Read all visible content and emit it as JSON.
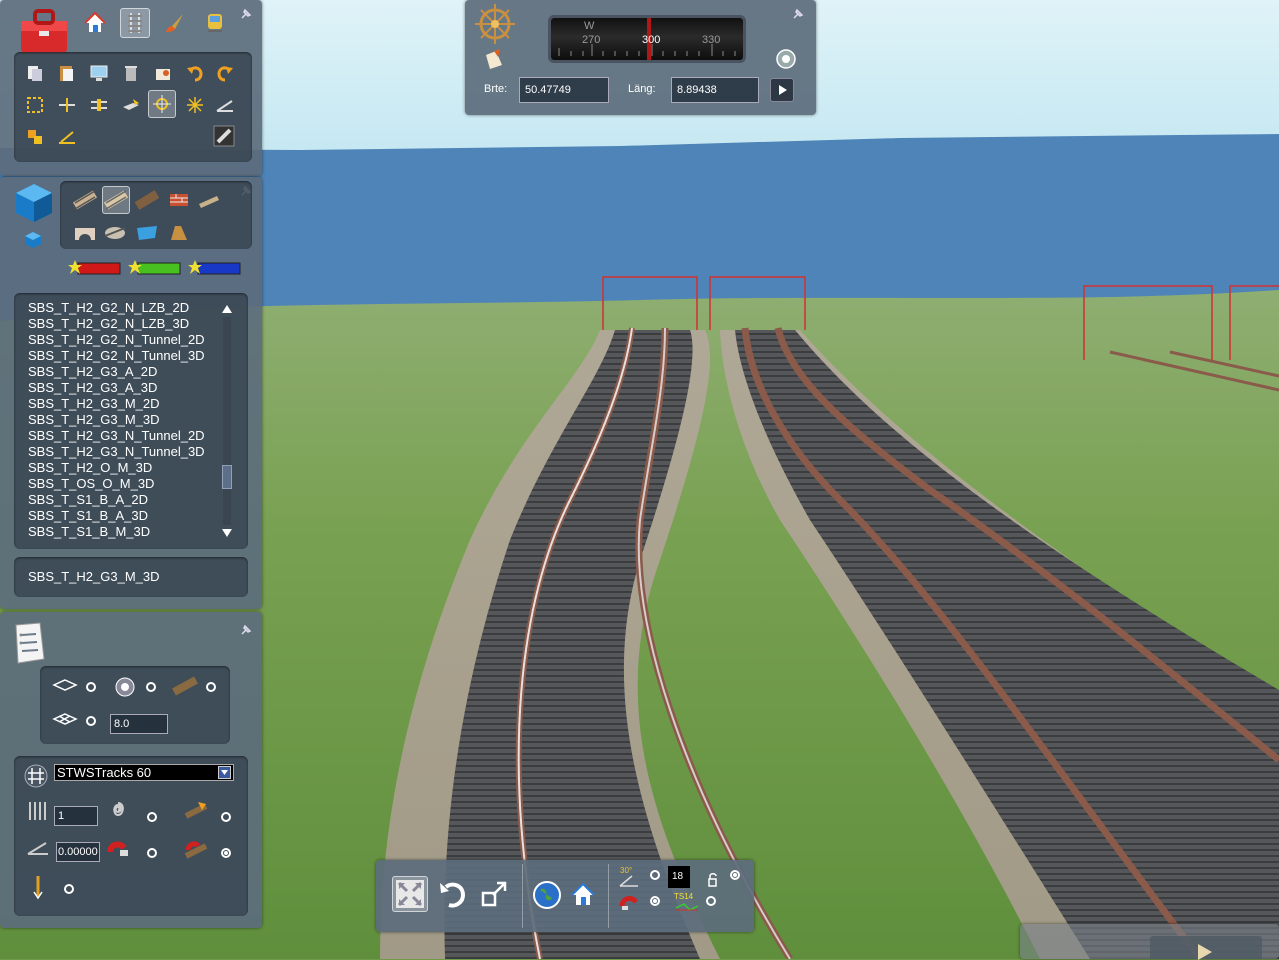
{
  "compass": {
    "heading_direction": "W",
    "ticks": [
      "270",
      "300",
      "330"
    ],
    "lat_label": "Brte:",
    "lat_value": "50.47749",
    "lon_label": "Läng:",
    "lon_value": "8.89438"
  },
  "asset_list": {
    "items": [
      "SBS_T_H2_G2_N_LZB_2D",
      "SBS_T_H2_G2_N_LZB_3D",
      "SBS_T_H2_G2_N_Tunnel_2D",
      "SBS_T_H2_G2_N_Tunnel_3D",
      "SBS_T_H2_G3_A_2D",
      "SBS_T_H2_G3_A_3D",
      "SBS_T_H2_G3_M_2D",
      "SBS_T_H2_G3_M_3D",
      "SBS_T_H2_G3_N_Tunnel_2D",
      "SBS_T_H2_G3_N_Tunnel_3D",
      "SBS_T_H2_O_M_3D",
      "SBS_T_OS_O_M_3D",
      "SBS_T_S1_B_A_2D",
      "SBS_T_S1_B_A_3D",
      "SBS_T_S1_B_M_3D"
    ],
    "selected": "SBS_T_H2_G3_M_3D"
  },
  "properties": {
    "height_value": "8.0",
    "track_type": "STWSTracks 60",
    "count_value": "1",
    "gradient_value": "0.00000"
  },
  "bottom_bar": {
    "angle_label": "30°",
    "grid_value": "18",
    "ts_label": "TS14"
  },
  "colors": {
    "sky": "#ccecf4",
    "sea": "#4f84b8",
    "grass": "#6f9a48",
    "panel": "#5c6c7c",
    "rail": "#8a5a4a"
  }
}
